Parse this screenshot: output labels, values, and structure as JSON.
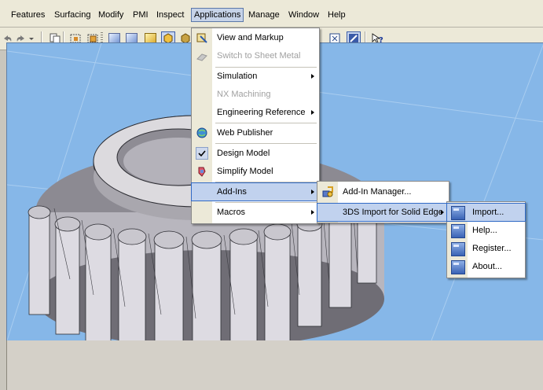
{
  "menubar": {
    "items": [
      "Features",
      "Surfacing",
      "Modify",
      "PMI",
      "Inspect",
      "Applications",
      "Manage",
      "Window",
      "Help"
    ]
  },
  "applications_menu": {
    "items": [
      {
        "label": "View and Markup",
        "icon": "view-markup-icon"
      },
      {
        "label": "Switch to Sheet Metal",
        "icon": "sheet-metal-icon",
        "disabled": true
      },
      {
        "label": "Simulation",
        "submenu": true
      },
      {
        "label": "NX Machining",
        "disabled": true
      },
      {
        "label": "Engineering Reference",
        "submenu": true
      },
      {
        "label": "Web Publisher",
        "icon": "web-publisher-icon"
      },
      {
        "label": "Design Model",
        "icon": "checkmark-icon"
      },
      {
        "label": "Simplify Model",
        "icon": "simplify-model-icon"
      },
      {
        "label": "Add-Ins",
        "submenu": true,
        "highlighted": true
      },
      {
        "label": "Macros",
        "submenu": true
      }
    ]
  },
  "addins_menu": {
    "items": [
      {
        "label": "Add-In Manager...",
        "icon": "add-in-manager-icon"
      },
      {
        "label": "3DS Import for Solid Edge",
        "submenu": true,
        "highlighted": true
      }
    ]
  },
  "import_menu": {
    "items": [
      {
        "label": "Import...",
        "icon": "calculator-icon",
        "highlighted": true
      },
      {
        "label": "Help...",
        "icon": "calculator-icon"
      },
      {
        "label": "Register...",
        "icon": "calculator-icon"
      },
      {
        "label": "About...",
        "icon": "calculator-icon"
      }
    ]
  },
  "colors": {
    "viewport_bg": "#86b7e8",
    "menu_highlight": "#c1d2ee",
    "part_face": "#d8d6dc"
  }
}
